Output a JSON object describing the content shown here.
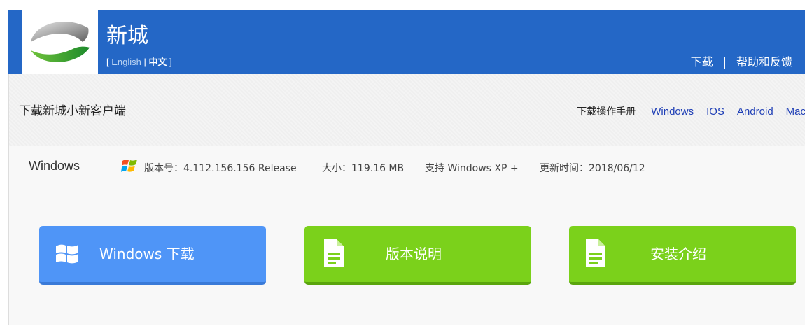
{
  "header": {
    "brand_name": "新城",
    "lang_open": "[",
    "lang_english": "English",
    "lang_sep": "|",
    "lang_chinese": "中文",
    "lang_close": "]",
    "nav_download": "下载",
    "nav_sep": "|",
    "nav_help": "帮助和反馈"
  },
  "page": {
    "title": "下载新城小新客户端",
    "subnav": {
      "manual": "下载操作手册",
      "platforms": [
        "Windows",
        "IOS",
        "Android",
        "Mac"
      ]
    }
  },
  "info": {
    "os_name": "Windows",
    "version": "版本号：4.112.156.156 Release",
    "size": "大小：119.16 MB",
    "support": "支持 Windows XP +",
    "updated": "更新时间：2018/06/12"
  },
  "buttons": {
    "download": "Windows 下载",
    "release_notes": "版本说明",
    "install_guide": "安装介绍"
  },
  "colors": {
    "header_bg": "#2467c6",
    "download_btn": "#4f95f7",
    "green_btn": "#7bd11b",
    "link_blue": "#1f3fb6"
  }
}
